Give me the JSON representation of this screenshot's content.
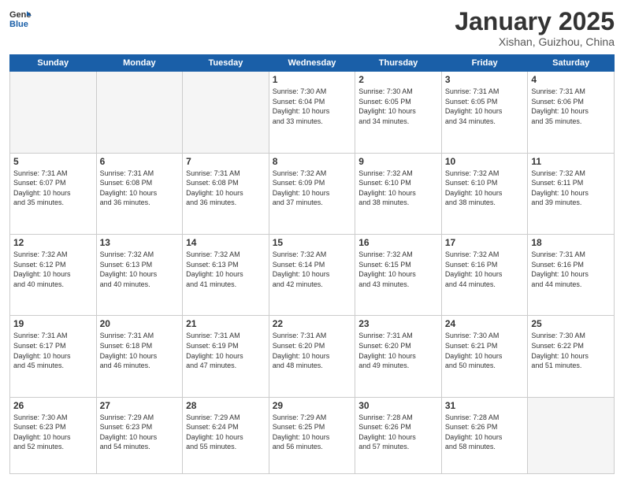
{
  "header": {
    "logo_general": "General",
    "logo_blue": "Blue",
    "month_year": "January 2025",
    "location": "Xishan, Guizhou, China"
  },
  "days_of_week": [
    "Sunday",
    "Monday",
    "Tuesday",
    "Wednesday",
    "Thursday",
    "Friday",
    "Saturday"
  ],
  "weeks": [
    [
      {
        "day": "",
        "info": ""
      },
      {
        "day": "",
        "info": ""
      },
      {
        "day": "",
        "info": ""
      },
      {
        "day": "1",
        "info": "Sunrise: 7:30 AM\nSunset: 6:04 PM\nDaylight: 10 hours\nand 33 minutes."
      },
      {
        "day": "2",
        "info": "Sunrise: 7:30 AM\nSunset: 6:05 PM\nDaylight: 10 hours\nand 34 minutes."
      },
      {
        "day": "3",
        "info": "Sunrise: 7:31 AM\nSunset: 6:05 PM\nDaylight: 10 hours\nand 34 minutes."
      },
      {
        "day": "4",
        "info": "Sunrise: 7:31 AM\nSunset: 6:06 PM\nDaylight: 10 hours\nand 35 minutes."
      }
    ],
    [
      {
        "day": "5",
        "info": "Sunrise: 7:31 AM\nSunset: 6:07 PM\nDaylight: 10 hours\nand 35 minutes."
      },
      {
        "day": "6",
        "info": "Sunrise: 7:31 AM\nSunset: 6:08 PM\nDaylight: 10 hours\nand 36 minutes."
      },
      {
        "day": "7",
        "info": "Sunrise: 7:31 AM\nSunset: 6:08 PM\nDaylight: 10 hours\nand 36 minutes."
      },
      {
        "day": "8",
        "info": "Sunrise: 7:32 AM\nSunset: 6:09 PM\nDaylight: 10 hours\nand 37 minutes."
      },
      {
        "day": "9",
        "info": "Sunrise: 7:32 AM\nSunset: 6:10 PM\nDaylight: 10 hours\nand 38 minutes."
      },
      {
        "day": "10",
        "info": "Sunrise: 7:32 AM\nSunset: 6:10 PM\nDaylight: 10 hours\nand 38 minutes."
      },
      {
        "day": "11",
        "info": "Sunrise: 7:32 AM\nSunset: 6:11 PM\nDaylight: 10 hours\nand 39 minutes."
      }
    ],
    [
      {
        "day": "12",
        "info": "Sunrise: 7:32 AM\nSunset: 6:12 PM\nDaylight: 10 hours\nand 40 minutes."
      },
      {
        "day": "13",
        "info": "Sunrise: 7:32 AM\nSunset: 6:13 PM\nDaylight: 10 hours\nand 40 minutes."
      },
      {
        "day": "14",
        "info": "Sunrise: 7:32 AM\nSunset: 6:13 PM\nDaylight: 10 hours\nand 41 minutes."
      },
      {
        "day": "15",
        "info": "Sunrise: 7:32 AM\nSunset: 6:14 PM\nDaylight: 10 hours\nand 42 minutes."
      },
      {
        "day": "16",
        "info": "Sunrise: 7:32 AM\nSunset: 6:15 PM\nDaylight: 10 hours\nand 43 minutes."
      },
      {
        "day": "17",
        "info": "Sunrise: 7:32 AM\nSunset: 6:16 PM\nDaylight: 10 hours\nand 44 minutes."
      },
      {
        "day": "18",
        "info": "Sunrise: 7:31 AM\nSunset: 6:16 PM\nDaylight: 10 hours\nand 44 minutes."
      }
    ],
    [
      {
        "day": "19",
        "info": "Sunrise: 7:31 AM\nSunset: 6:17 PM\nDaylight: 10 hours\nand 45 minutes."
      },
      {
        "day": "20",
        "info": "Sunrise: 7:31 AM\nSunset: 6:18 PM\nDaylight: 10 hours\nand 46 minutes."
      },
      {
        "day": "21",
        "info": "Sunrise: 7:31 AM\nSunset: 6:19 PM\nDaylight: 10 hours\nand 47 minutes."
      },
      {
        "day": "22",
        "info": "Sunrise: 7:31 AM\nSunset: 6:20 PM\nDaylight: 10 hours\nand 48 minutes."
      },
      {
        "day": "23",
        "info": "Sunrise: 7:31 AM\nSunset: 6:20 PM\nDaylight: 10 hours\nand 49 minutes."
      },
      {
        "day": "24",
        "info": "Sunrise: 7:30 AM\nSunset: 6:21 PM\nDaylight: 10 hours\nand 50 minutes."
      },
      {
        "day": "25",
        "info": "Sunrise: 7:30 AM\nSunset: 6:22 PM\nDaylight: 10 hours\nand 51 minutes."
      }
    ],
    [
      {
        "day": "26",
        "info": "Sunrise: 7:30 AM\nSunset: 6:23 PM\nDaylight: 10 hours\nand 52 minutes."
      },
      {
        "day": "27",
        "info": "Sunrise: 7:29 AM\nSunset: 6:23 PM\nDaylight: 10 hours\nand 54 minutes."
      },
      {
        "day": "28",
        "info": "Sunrise: 7:29 AM\nSunset: 6:24 PM\nDaylight: 10 hours\nand 55 minutes."
      },
      {
        "day": "29",
        "info": "Sunrise: 7:29 AM\nSunset: 6:25 PM\nDaylight: 10 hours\nand 56 minutes."
      },
      {
        "day": "30",
        "info": "Sunrise: 7:28 AM\nSunset: 6:26 PM\nDaylight: 10 hours\nand 57 minutes."
      },
      {
        "day": "31",
        "info": "Sunrise: 7:28 AM\nSunset: 6:26 PM\nDaylight: 10 hours\nand 58 minutes."
      },
      {
        "day": "",
        "info": ""
      }
    ]
  ]
}
